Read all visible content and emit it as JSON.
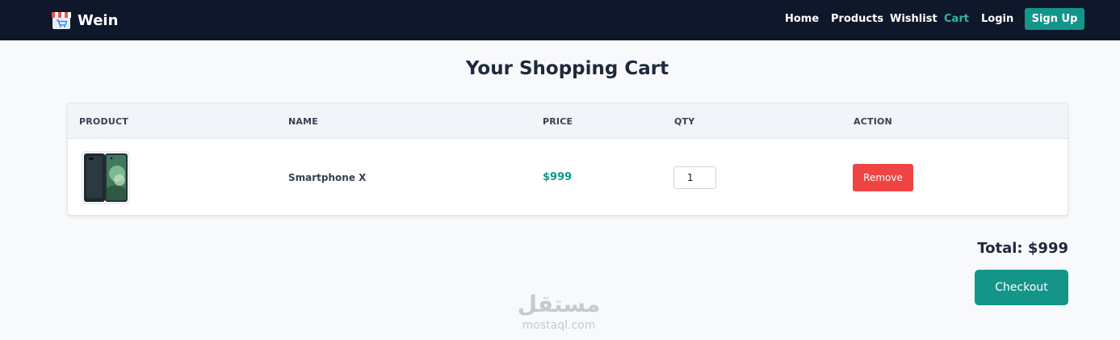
{
  "navbar": {
    "brand": "Wein",
    "links": [
      {
        "label": "Home"
      },
      {
        "label": "Products"
      },
      {
        "label": "Wishlist"
      },
      {
        "label": "Cart",
        "active": true
      },
      {
        "label": "Login"
      }
    ],
    "signup_label": "Sign Up",
    "icon": "store-logo-icon"
  },
  "page": {
    "title": "Your Shopping Cart"
  },
  "table": {
    "headers": [
      "PRODUCT",
      "NAME",
      "PRICE",
      "QTY",
      "ACTION"
    ],
    "rows": [
      {
        "image_icon": "smartphone-image",
        "name": "Smartphone X",
        "price": "$999",
        "qty": "1",
        "action_label": "Remove"
      }
    ]
  },
  "summary": {
    "total_label": "Total: $999",
    "checkout_label": "Checkout"
  },
  "watermark": {
    "arabic": "مستقل",
    "latin": "mostaql.com"
  },
  "colors": {
    "navbar_bg": "#0f172a",
    "accent": "#14958a",
    "active_link": "#2fb5a8",
    "danger": "#ef4444",
    "page_bg": "#f8f9fb"
  }
}
